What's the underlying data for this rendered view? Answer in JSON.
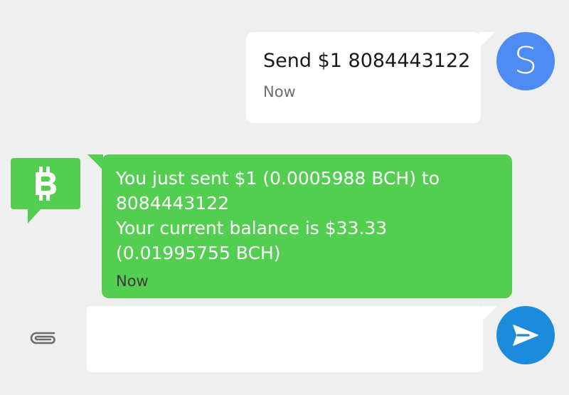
{
  "outgoing_message": {
    "text": "Send $1 8084443122",
    "time": "Now",
    "avatar_letter": "S",
    "avatar_color": "#4e8cf3"
  },
  "incoming_message": {
    "icon": "bitcoin-cash-icon",
    "lines": [
      "You just sent $1 (0.0005988 BCH) to",
      "8084443122",
      "Your current balance is $33.33",
      "(0.01995755 BCH)"
    ],
    "time": "Now",
    "bubble_color": "#53ce51"
  },
  "composer": {
    "attach_icon": "paperclip-icon",
    "value": "",
    "send_icon": "send-icon",
    "send_color": "#1c8bdb"
  }
}
